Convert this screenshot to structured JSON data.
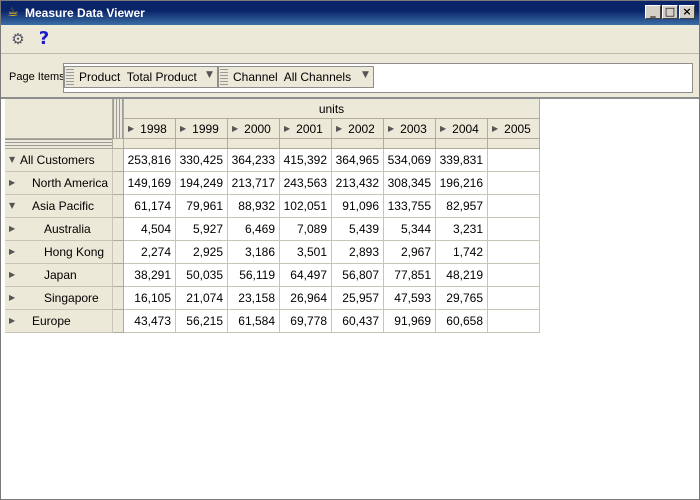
{
  "window": {
    "title": "Measure Data Viewer"
  },
  "toolbar": {
    "help_symbol": "?"
  },
  "page_items": {
    "label": "Page Items",
    "items": [
      {
        "label": "Product  Total Product"
      },
      {
        "label": "Channel  All Channels"
      }
    ]
  },
  "grid": {
    "measure": "units",
    "years": [
      "1998",
      "1999",
      "2000",
      "2001",
      "2002",
      "2003",
      "2004",
      "2005"
    ],
    "rows": [
      {
        "label": "All Customers",
        "expanded": true,
        "values": [
          "253,816",
          "330,425",
          "364,233",
          "415,392",
          "364,965",
          "534,069",
          "339,831",
          ""
        ]
      },
      {
        "label": "North America",
        "expanded": false,
        "values": [
          "149,169",
          "194,249",
          "213,717",
          "243,563",
          "213,432",
          "308,345",
          "196,216",
          ""
        ]
      },
      {
        "label": "Asia Pacific",
        "expanded": true,
        "values": [
          "61,174",
          "79,961",
          "88,932",
          "102,051",
          "91,096",
          "133,755",
          "82,957",
          ""
        ]
      },
      {
        "label": "Australia",
        "expanded": false,
        "values": [
          "4,504",
          "5,927",
          "6,469",
          "7,089",
          "5,439",
          "5,344",
          "3,231",
          ""
        ]
      },
      {
        "label": "Hong Kong",
        "expanded": false,
        "values": [
          "2,274",
          "2,925",
          "3,186",
          "3,501",
          "2,893",
          "2,967",
          "1,742",
          ""
        ]
      },
      {
        "label": "Japan",
        "expanded": false,
        "values": [
          "38,291",
          "50,035",
          "56,119",
          "64,497",
          "56,807",
          "77,851",
          "48,219",
          ""
        ]
      },
      {
        "label": "Singapore",
        "expanded": false,
        "values": [
          "16,105",
          "21,074",
          "23,158",
          "26,964",
          "25,957",
          "47,593",
          "29,765",
          ""
        ]
      },
      {
        "label": "Europe",
        "expanded": false,
        "values": [
          "43,473",
          "56,215",
          "61,584",
          "69,778",
          "60,437",
          "91,969",
          "60,658",
          ""
        ]
      }
    ]
  }
}
